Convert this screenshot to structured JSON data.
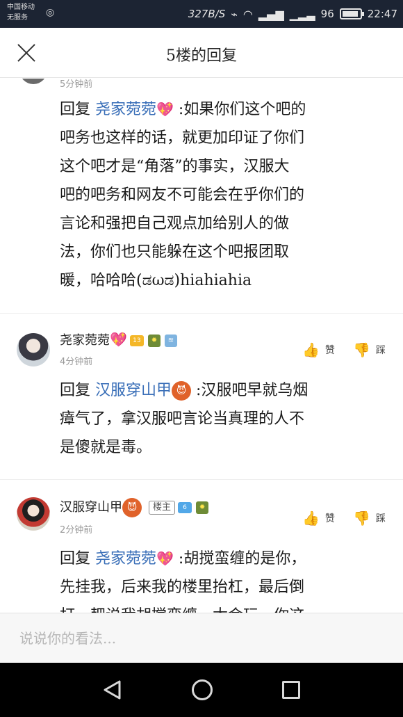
{
  "status_bar": {
    "carrier_line1": "中国移动",
    "carrier_line2": "无服务",
    "net_speed": "327B/S",
    "battery_level": "96",
    "battery_fraction": 0.9,
    "time": "22:47"
  },
  "header": {
    "title": "5楼的回复",
    "close_icon": "close-icon"
  },
  "top_partial": {
    "time": "5分钟前"
  },
  "reply_1": {
    "prefix": "回复",
    "mention": "尧家菀菀",
    "heart": "💖",
    "lines": [
      " :如果你们这个吧的",
      "吧务也这样的话，就更加印证了你们",
      "这个吧才是“角落”的事实，汉服大",
      "吧的吧务和网友不可能会在乎你们的",
      "言论和强把自己观点加给别人的做",
      "法，你们也只能躲在这个吧报团取",
      "暖，哈哈哈(ಡωಡ)hiahiahia"
    ]
  },
  "comment_1": {
    "username": "尧家菀菀",
    "heart": "💖",
    "level": "13",
    "time": "4分钟前",
    "like_label": "赞",
    "dislike_label": "踩",
    "reply_prefix": "回复",
    "mention": "汉服穿山甲",
    "mention_emoji": "😈",
    "lines": [
      " :汉服吧早就乌烟",
      "瘴气了，拿汉服吧言论当真理的人不",
      "是傻就是毒。"
    ]
  },
  "comment_2": {
    "username": "汉服穿山甲",
    "emoji": "😈",
    "owner_badge": "楼主",
    "level": "6",
    "time": "2分钟前",
    "like_label": "赞",
    "dislike_label": "踩",
    "reply_prefix": "回复",
    "mention": "尧家菀菀",
    "heart": "💖",
    "lines": [
      " :胡搅蛮缠的是你，",
      "先挂我，后来我的楼里抬杠，最后倒",
      "打一耙说我胡搅蛮缠，太会玩，你这"
    ]
  },
  "input": {
    "placeholder": "说说你的看法..."
  },
  "colors": {
    "mention": "#3a6fb8",
    "status_bar_bg": "#1c2433",
    "nav_bg": "#000000"
  }
}
